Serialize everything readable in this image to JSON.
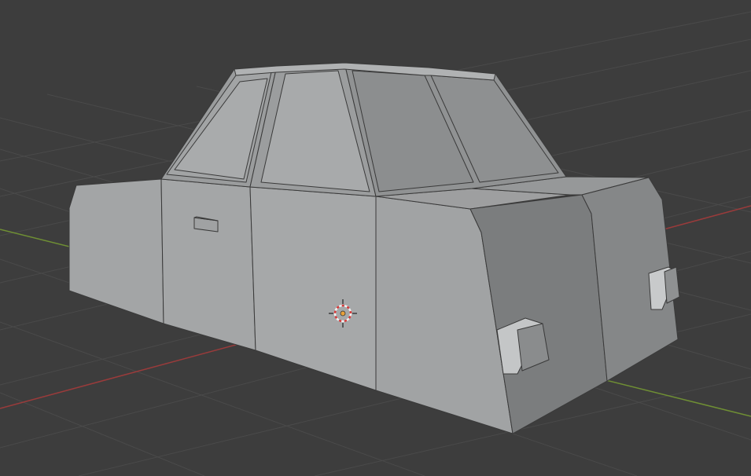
{
  "viewport": {
    "background": "#3d3d3d",
    "grid_color": "#4a4a4a",
    "x_axis_color": "#9a3b3b",
    "y_axis_color": "#6f8f34"
  },
  "object": {
    "kind": "low-poly car mesh",
    "face_light": "#a8aaab",
    "face_mid": "#999b9c",
    "face_dark": "#7c7e7f",
    "edge": "#3a3a3a"
  },
  "cursor_3d": {
    "icon": "3d-cursor-icon",
    "ring_red": "#d93a3a",
    "ring_white": "#f0f0f0",
    "origin": "#e8a13a"
  }
}
